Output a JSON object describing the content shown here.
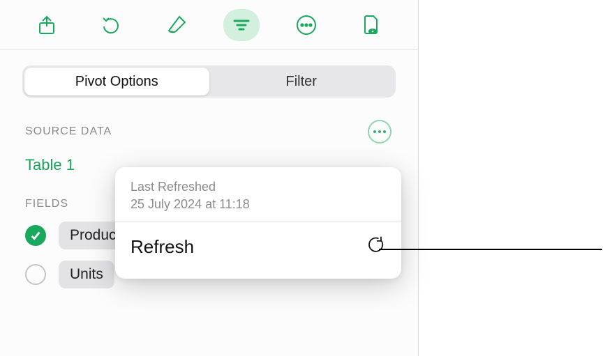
{
  "toolbar": {
    "share_icon": "share-icon",
    "undo_icon": "undo-icon",
    "format_icon": "paintbrush-icon",
    "organise_icon": "filter-icon",
    "more_icon": "ellipsis-icon",
    "doc_icon": "document-icon"
  },
  "segments": {
    "pivot": "Pivot Options",
    "filter": "Filter"
  },
  "sourceData": {
    "header": "SOURCE DATA",
    "table": "Table 1"
  },
  "fields": {
    "header": "FIELDS",
    "items": [
      {
        "label": "Product",
        "checked": true
      },
      {
        "label": "Units",
        "checked": false
      }
    ]
  },
  "popover": {
    "lastRefreshedLabel": "Last Refreshed",
    "lastRefreshedValue": "25 July 2024  at 11:18",
    "refreshLabel": "Refresh"
  }
}
